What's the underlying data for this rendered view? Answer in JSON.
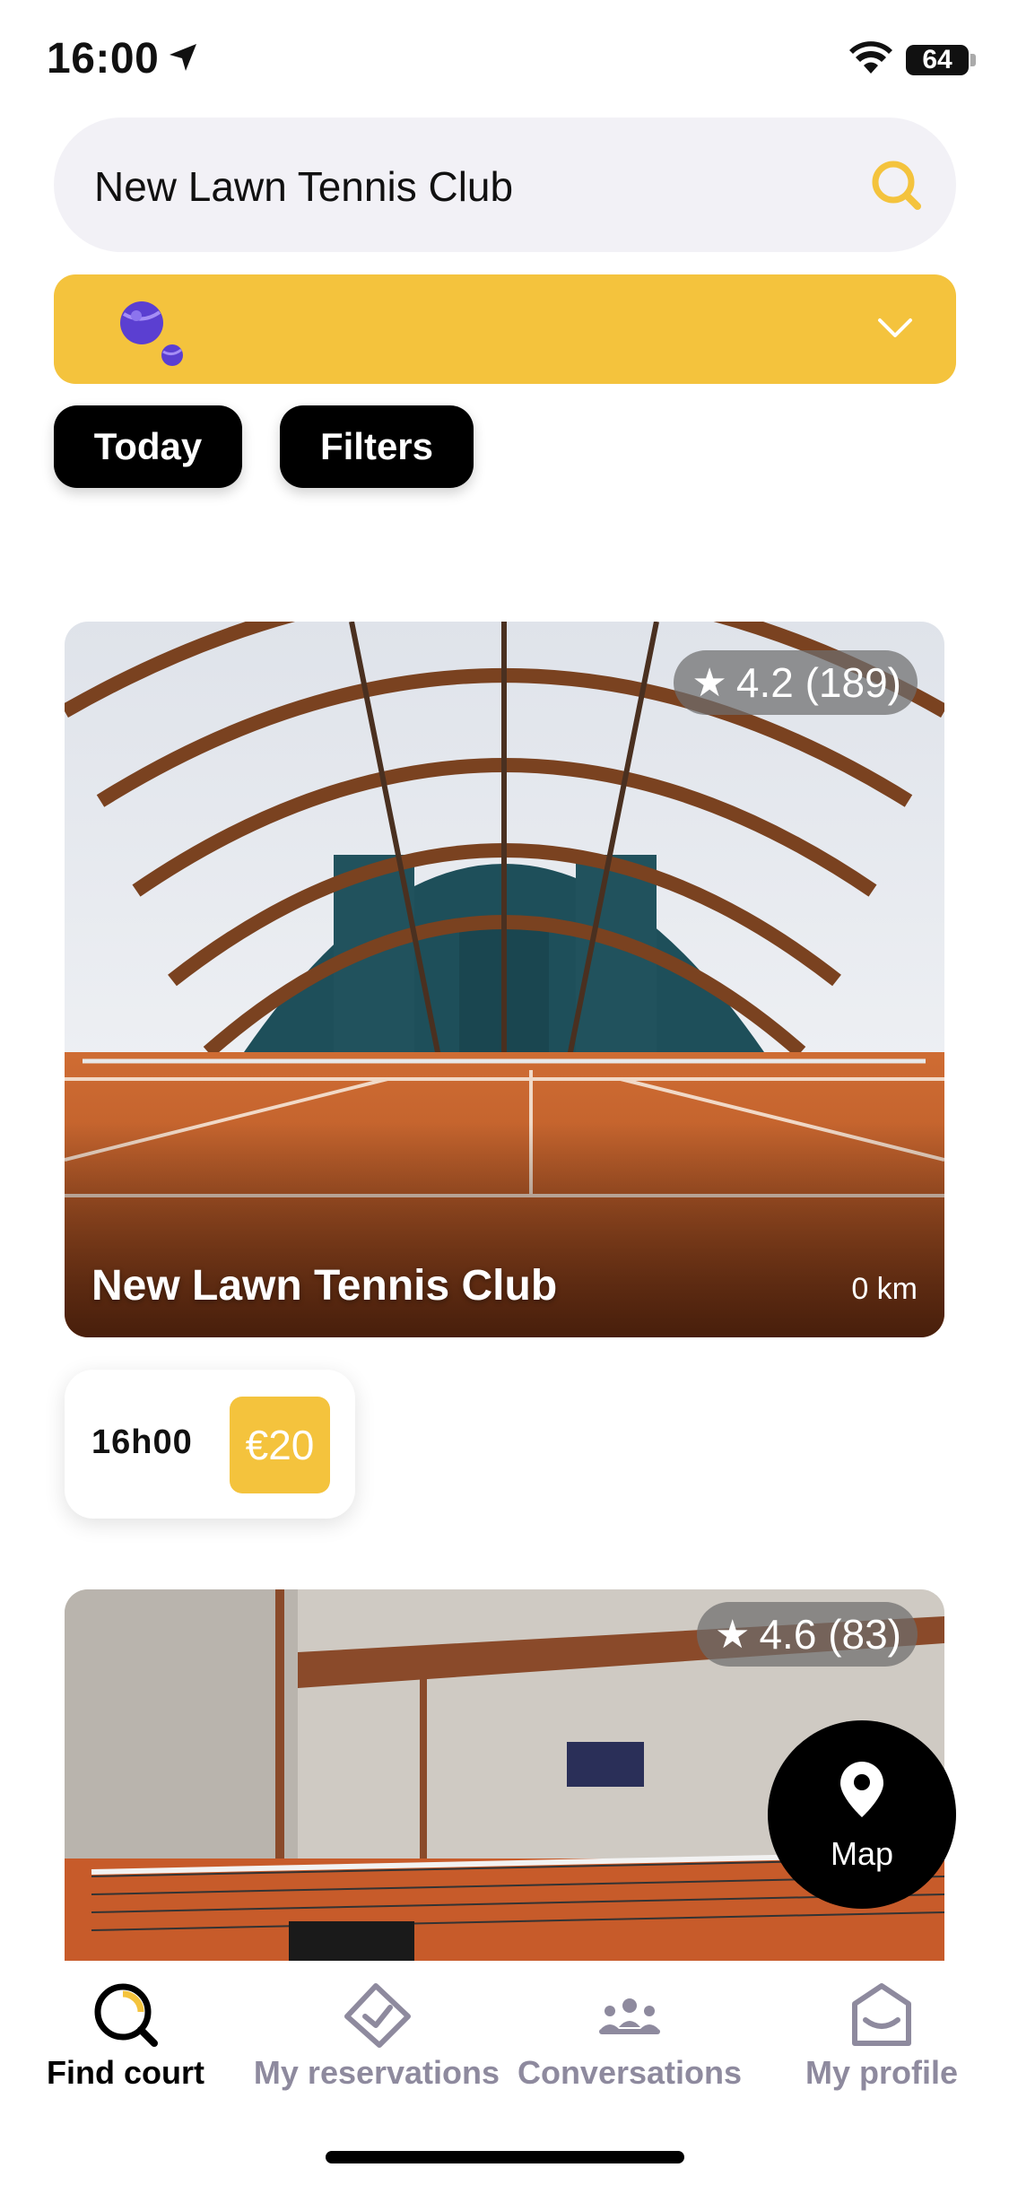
{
  "status_bar": {
    "time": "16:00",
    "battery": "64"
  },
  "search": {
    "value": "New Lawn Tennis Club",
    "icon": "search-icon"
  },
  "sport_selector": {
    "icon": "tennis-balls-icon",
    "chevron": "chevron-down-icon"
  },
  "filters": {
    "today_label": "Today",
    "filters_label": "Filters"
  },
  "clubs": [
    {
      "name": "New Lawn Tennis Club",
      "rating": "4.2 (189)",
      "distance": "0 km",
      "slot_time": "16h00",
      "slot_price": "€20"
    },
    {
      "rating": "4.6 (83)"
    }
  ],
  "map_button": {
    "label": "Map",
    "icon": "map-pin-icon"
  },
  "tabs": [
    {
      "label": "Find court",
      "icon": "find-court-icon",
      "active": true
    },
    {
      "label": "My reservations",
      "icon": "ticket-check-icon",
      "active": false
    },
    {
      "label": "Conversations",
      "icon": "people-icon",
      "active": false
    },
    {
      "label": "My profile",
      "icon": "profile-icon",
      "active": false
    }
  ],
  "colors": {
    "accent": "#f4c33d",
    "search_bg": "#f2f1f6",
    "tab_inactive": "#8e8a9e",
    "clay": "#c4622b"
  }
}
